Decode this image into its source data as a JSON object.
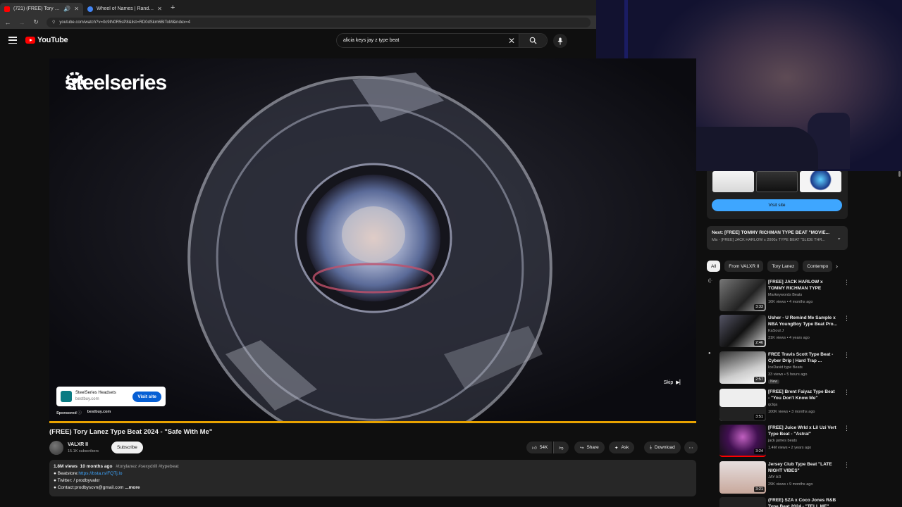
{
  "browser": {
    "tabs": [
      {
        "title": "(721) (FREE) Tory Lanez Type",
        "active": true,
        "favicon_color": "#ff0000"
      },
      {
        "title": "Wheel of Names | Random nam",
        "active": false,
        "favicon_color": "#4285f4"
      }
    ],
    "url": "youtube.com/watch?v=0c9lN0R5sP8&list=RD0dSkm6BiToM&index=4"
  },
  "header": {
    "logo_text": "YouTube",
    "search_value": "alicia keys jay z type beat"
  },
  "video": {
    "brand_logo": "steelseries",
    "ad_advertiser": "SteelSeries Headsets",
    "ad_domain": "bestbuy.com",
    "visit_label": "Visit site",
    "sponsored_label": "Sponsored",
    "sponsored_domain": "bestbuy.com",
    "skip_label": "Skip",
    "progress": 1.0
  },
  "meta": {
    "title": "(FREE) Tory Lanez Type Beat 2024 - \"Safe With Me\"",
    "channel_name": "VALXR II",
    "subscribers": "15.1K subscribers",
    "subscribe_label": "Subscribe",
    "likes": "54K",
    "share_label": "Share",
    "ask_label": "Ask",
    "download_label": "Download"
  },
  "description": {
    "views": "1.8M views",
    "age": "10 months ago",
    "tags": "#torylanez #sexydrill #typebeat",
    "beatstore_label": "Beatstore:",
    "beatstore_link": "https://bsta.rs/FQTj.lo",
    "twitter_label": "Twitter:",
    "twitter_handle": "/ prodbyvalxr",
    "contact": "Contact:prodbyscvn@gmail.com",
    "more_label": "...more"
  },
  "sidebar": {
    "visit_site_label": "Visit site",
    "next_title": "Next: [FREE] TOMMY RICHMAN TYPE BEAT \"MOVIE...",
    "next_sub": "Mix - [FREE] JACK HARLOW x 2000s TYPE BEAT \"SLIDE THR...",
    "chips": [
      "All",
      "From VALXR II",
      "Tory Lanez",
      "Contempo"
    ],
    "recommendations": [
      {
        "title": "[FREE] JACK HARLOW x TOMMY RICHMAN TYPE BEAT...",
        "channel": "Markeywords Beats",
        "meta": "16K views • 4 months ago",
        "duration": "3:33",
        "mark": "((·",
        "new": ""
      },
      {
        "title": "Usher - U Remind Me Sample x NBA YoungBoy Type Beat Pro...",
        "channel": "KaSoul J",
        "meta": "31K views • 4 years ago",
        "duration": "2:46",
        "mark": "",
        "new": ""
      },
      {
        "title": "FREE Travis Scott Type Beat - Cyber Drip | Hard Trap ...",
        "channel": "IceDavid type Beats",
        "meta": "33 views • 5 hours ago",
        "duration": "2:57",
        "mark": "●",
        "new": "New"
      },
      {
        "title": "[FREE] Brent Faiyaz Type Beat - \"You Don't Know Me\"",
        "channel": "qclqa",
        "meta": "100K views • 3 months ago",
        "duration": "3:51",
        "mark": "",
        "new": ""
      },
      {
        "title": "[FREE] Juice Wrld x Lil Uzi Vert Type Beat - \"Astral\"",
        "channel": "jack james beats",
        "meta": "1.4M views • 2 years ago",
        "duration": "3:24",
        "mark": "",
        "new": ""
      },
      {
        "title": "Jersey Club Type Beat \"LATE NIGHT VIBES\"",
        "channel": "JAY AR",
        "meta": "29K views • 9 months ago",
        "duration": "3:21",
        "mark": "",
        "new": ""
      },
      {
        "title": "(FREE) SZA x Coco Jones R&B Type Beat 2024 - \"TELL ME\"",
        "channel": "",
        "meta": "",
        "duration": "",
        "mark": "",
        "new": ""
      }
    ]
  }
}
